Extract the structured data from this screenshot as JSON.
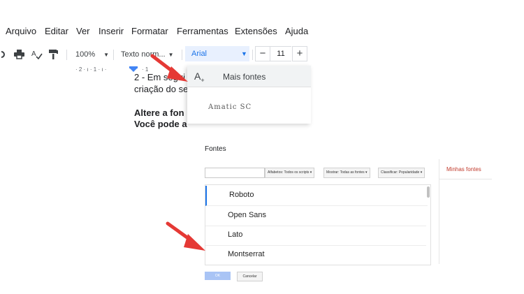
{
  "menubar": {
    "items": [
      "Arquivo",
      "Editar",
      "Ver",
      "Inserir",
      "Formatar",
      "Ferramentas",
      "Extensões",
      "Ajuda"
    ]
  },
  "toolbar": {
    "zoom": "100%",
    "style": "Texto norm...",
    "font": "Arial",
    "font_size": "11",
    "minus": "−",
    "plus": "+"
  },
  "ruler": {
    "marks": "· 2 · ı · 1 · ı ·"
  },
  "document": {
    "line1": "2 - Em segui",
    "line2": "criação do se",
    "line3": "Altere a fon",
    "line4": "Você pode a"
  },
  "font_menu": {
    "more_fonts": "Mais fontes",
    "first_font": "Amatic SC"
  },
  "fonts_dialog": {
    "title": "Fontes",
    "filters": {
      "scripts": "Alfabetos: Todos os scripts",
      "show": "Mostrar: Todas as fontes",
      "sort": "Classificar: Popularidade"
    },
    "fonts": [
      "Roboto",
      "Open Sans",
      "Lato",
      "Montserrat"
    ],
    "my_fonts": "Minhas fontes",
    "ok": "OK",
    "cancel": "Cancelar"
  },
  "colors": {
    "accent": "#1a73e8",
    "arrow": "#e53935",
    "my_fonts": "#c0392b"
  }
}
